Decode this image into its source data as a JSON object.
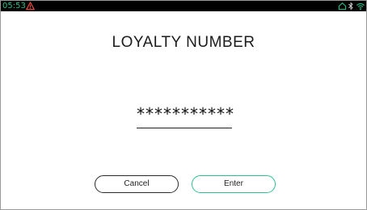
{
  "status_bar": {
    "time": "05:53",
    "icons": [
      "warning-icon",
      "home-icon",
      "bluetooth-icon",
      "wifi-icon"
    ],
    "time_color": "#27c08f",
    "warning_color": "#e5483c"
  },
  "screen": {
    "title": "LOYALTY NUMBER",
    "input_value": "***********"
  },
  "buttons": {
    "cancel_label": "Cancel",
    "enter_label": "Enter",
    "accent_color": "#29c293"
  }
}
